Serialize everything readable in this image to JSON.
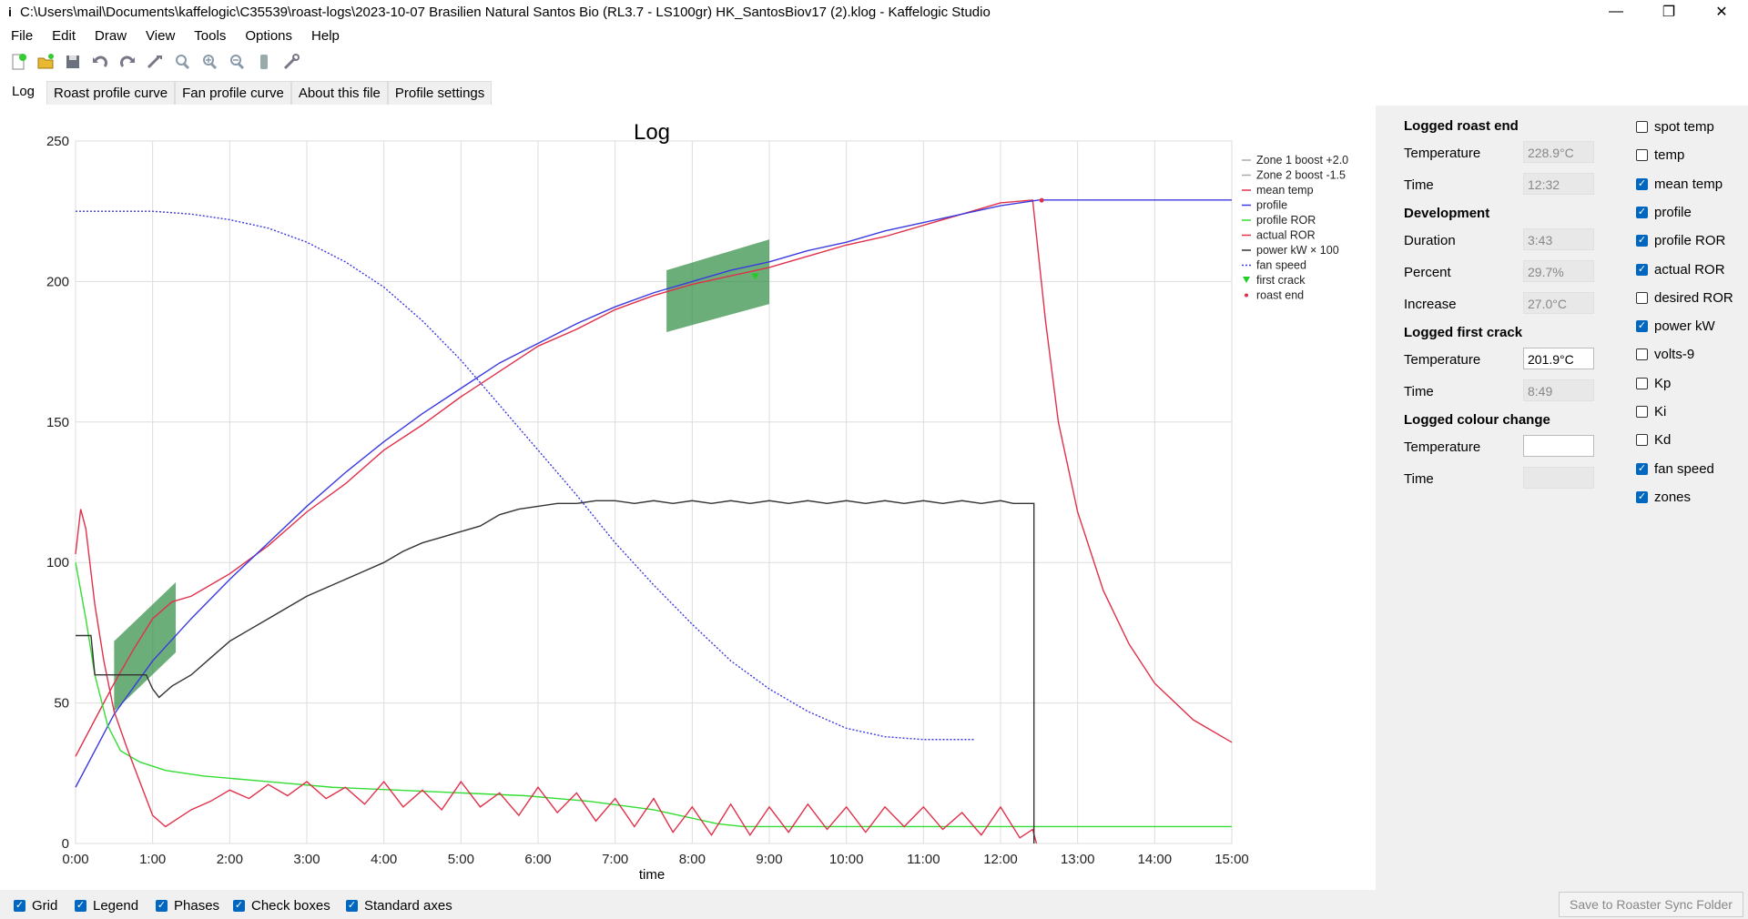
{
  "window": {
    "title": "C:\\Users\\mail\\Documents\\kaffelogic\\C35539\\roast-logs\\2023-10-07 Brasilien Natural Santos Bio (RL3.7 - LS100gr) HK_SantosBiov17 (2).klog - Kaffelogic Studio",
    "minimize": "—",
    "restore": "❐",
    "close": "✕"
  },
  "menu": [
    "File",
    "Edit",
    "Draw",
    "View",
    "Tools",
    "Options",
    "Help"
  ],
  "toolbar_icons": [
    "new-file-icon",
    "open-folder-icon",
    "save-icon",
    "undo-icon",
    "redo-icon",
    "measure-icon",
    "zoom-reset-icon",
    "zoom-in-icon",
    "zoom-out-icon",
    "roaster-icon",
    "settings-wand-icon"
  ],
  "tabs": [
    "Log",
    "Roast profile curve",
    "Fan profile curve",
    "About this file",
    "Profile settings"
  ],
  "chart_data": {
    "type": "line",
    "title": "Log",
    "xlabel": "time",
    "ylabel": "",
    "xlim": [
      0,
      900
    ],
    "ylim": [
      0,
      250
    ],
    "x_ticks": [
      "0:00",
      "1:00",
      "2:00",
      "3:00",
      "4:00",
      "5:00",
      "6:00",
      "7:00",
      "8:00",
      "9:00",
      "10:00",
      "11:00",
      "12:00",
      "13:00",
      "14:00",
      "15:00"
    ],
    "y_ticks": [
      0,
      50,
      100,
      150,
      200,
      250
    ],
    "grid": true,
    "legend_position": "top-right",
    "legend": [
      {
        "name": "Zone 1 boost +2.0",
        "color": "#aaaaaa",
        "style": "line"
      },
      {
        "name": "Zone 2 boost -1.5",
        "color": "#aaaaaa",
        "style": "line"
      },
      {
        "name": "mean temp",
        "color": "#e0304a",
        "style": "line"
      },
      {
        "name": "profile",
        "color": "#3a3ae0",
        "style": "line"
      },
      {
        "name": "profile ROR",
        "color": "#33dd33",
        "style": "line"
      },
      {
        "name": "actual ROR",
        "color": "#e0304a",
        "style": "line"
      },
      {
        "name": "power kW × 100",
        "color": "#333333",
        "style": "line"
      },
      {
        "name": "fan speed",
        "color": "#3a3ae0",
        "style": "dotted"
      },
      {
        "name": "first crack",
        "color": "#22cc22",
        "style": "triangle"
      },
      {
        "name": "roast end",
        "color": "#e0304a",
        "style": "dot"
      }
    ],
    "zones": [
      {
        "name": "Zone 1 boost +2.0",
        "points": [
          [
            30,
            47
          ],
          [
            30,
            72
          ],
          [
            78,
            93
          ],
          [
            78,
            68
          ]
        ],
        "color": "#2e8b40"
      },
      {
        "name": "Zone 2 boost -1.5",
        "points": [
          [
            460,
            182
          ],
          [
            460,
            204
          ],
          [
            540,
            215
          ],
          [
            540,
            192
          ]
        ],
        "color": "#2e8b40"
      }
    ],
    "series": [
      {
        "name": "mean temp",
        "color": "#e0304a",
        "points": [
          [
            0,
            31
          ],
          [
            15,
            44
          ],
          [
            30,
            57
          ],
          [
            45,
            69
          ],
          [
            60,
            80
          ],
          [
            75,
            86
          ],
          [
            90,
            88
          ],
          [
            120,
            96
          ],
          [
            150,
            106
          ],
          [
            180,
            118
          ],
          [
            210,
            128
          ],
          [
            240,
            140
          ],
          [
            270,
            149
          ],
          [
            300,
            159
          ],
          [
            330,
            168
          ],
          [
            360,
            177
          ],
          [
            390,
            183
          ],
          [
            420,
            190
          ],
          [
            450,
            195
          ],
          [
            480,
            199
          ],
          [
            510,
            202
          ],
          [
            540,
            205
          ],
          [
            570,
            209
          ],
          [
            600,
            213
          ],
          [
            630,
            216
          ],
          [
            660,
            220
          ],
          [
            690,
            224
          ],
          [
            720,
            228
          ],
          [
            745,
            229
          ],
          [
            755,
            186
          ],
          [
            765,
            150
          ],
          [
            780,
            118
          ],
          [
            800,
            90
          ],
          [
            820,
            71
          ],
          [
            840,
            57
          ],
          [
            870,
            44
          ],
          [
            900,
            36
          ]
        ]
      },
      {
        "name": "profile",
        "color": "#3a3ae0",
        "points": [
          [
            0,
            20
          ],
          [
            30,
            46
          ],
          [
            60,
            65
          ],
          [
            90,
            80
          ],
          [
            120,
            94
          ],
          [
            150,
            107
          ],
          [
            180,
            120
          ],
          [
            210,
            132
          ],
          [
            240,
            143
          ],
          [
            270,
            153
          ],
          [
            300,
            162
          ],
          [
            330,
            171
          ],
          [
            360,
            178
          ],
          [
            390,
            185
          ],
          [
            420,
            191
          ],
          [
            450,
            196
          ],
          [
            480,
            200
          ],
          [
            510,
            204
          ],
          [
            540,
            207
          ],
          [
            570,
            211
          ],
          [
            600,
            214
          ],
          [
            630,
            218
          ],
          [
            660,
            221
          ],
          [
            690,
            224
          ],
          [
            720,
            227
          ],
          [
            750,
            229
          ],
          [
            900,
            229
          ]
        ]
      },
      {
        "name": "profile ROR",
        "color": "#33dd33",
        "points": [
          [
            0,
            100
          ],
          [
            8,
            80
          ],
          [
            15,
            60
          ],
          [
            25,
            42
          ],
          [
            35,
            33
          ],
          [
            50,
            29
          ],
          [
            70,
            26
          ],
          [
            100,
            24
          ],
          [
            150,
            22
          ],
          [
            200,
            20
          ],
          [
            250,
            19
          ],
          [
            300,
            18
          ],
          [
            350,
            17
          ],
          [
            400,
            15
          ],
          [
            450,
            12
          ],
          [
            460,
            11
          ],
          [
            480,
            9
          ],
          [
            500,
            7
          ],
          [
            520,
            6
          ],
          [
            900,
            6
          ]
        ]
      },
      {
        "name": "actual ROR",
        "color": "#e0304a",
        "points": [
          [
            0,
            103
          ],
          [
            4,
            119
          ],
          [
            8,
            112
          ],
          [
            15,
            85
          ],
          [
            22,
            65
          ],
          [
            30,
            47
          ],
          [
            40,
            34
          ],
          [
            50,
            22
          ],
          [
            60,
            10
          ],
          [
            70,
            6
          ],
          [
            80,
            9
          ],
          [
            90,
            12
          ],
          [
            105,
            15
          ],
          [
            120,
            19
          ],
          [
            135,
            16
          ],
          [
            150,
            21
          ],
          [
            165,
            17
          ],
          [
            180,
            22
          ],
          [
            195,
            16
          ],
          [
            210,
            20
          ],
          [
            225,
            14
          ],
          [
            240,
            22
          ],
          [
            255,
            13
          ],
          [
            270,
            19
          ],
          [
            285,
            12
          ],
          [
            300,
            22
          ],
          [
            315,
            13
          ],
          [
            330,
            18
          ],
          [
            345,
            10
          ],
          [
            360,
            20
          ],
          [
            375,
            11
          ],
          [
            390,
            18
          ],
          [
            405,
            8
          ],
          [
            420,
            16
          ],
          [
            435,
            6
          ],
          [
            450,
            16
          ],
          [
            465,
            4
          ],
          [
            480,
            13
          ],
          [
            495,
            3
          ],
          [
            510,
            14
          ],
          [
            525,
            3
          ],
          [
            540,
            13
          ],
          [
            555,
            4
          ],
          [
            570,
            14
          ],
          [
            585,
            5
          ],
          [
            600,
            13
          ],
          [
            615,
            4
          ],
          [
            630,
            13
          ],
          [
            645,
            6
          ],
          [
            660,
            13
          ],
          [
            675,
            5
          ],
          [
            690,
            11
          ],
          [
            705,
            3
          ],
          [
            720,
            13
          ],
          [
            735,
            2
          ],
          [
            745,
            5
          ],
          [
            748,
            0
          ]
        ]
      },
      {
        "name": "power kW × 100",
        "color": "#333333",
        "points": [
          [
            0,
            74
          ],
          [
            12,
            74
          ],
          [
            15,
            60
          ],
          [
            55,
            60
          ],
          [
            60,
            55
          ],
          [
            65,
            52
          ],
          [
            75,
            56
          ],
          [
            90,
            60
          ],
          [
            105,
            66
          ],
          [
            120,
            72
          ],
          [
            135,
            76
          ],
          [
            150,
            80
          ],
          [
            165,
            84
          ],
          [
            180,
            88
          ],
          [
            195,
            91
          ],
          [
            210,
            94
          ],
          [
            225,
            97
          ],
          [
            240,
            100
          ],
          [
            255,
            104
          ],
          [
            270,
            107
          ],
          [
            285,
            109
          ],
          [
            300,
            111
          ],
          [
            315,
            113
          ],
          [
            330,
            117
          ],
          [
            345,
            119
          ],
          [
            360,
            120
          ],
          [
            375,
            121
          ],
          [
            390,
            121
          ],
          [
            405,
            122
          ],
          [
            420,
            122
          ],
          [
            435,
            121
          ],
          [
            450,
            122
          ],
          [
            465,
            121
          ],
          [
            480,
            122
          ],
          [
            495,
            121
          ],
          [
            510,
            122
          ],
          [
            525,
            121
          ],
          [
            540,
            122
          ],
          [
            555,
            121
          ],
          [
            570,
            122
          ],
          [
            585,
            121
          ],
          [
            600,
            122
          ],
          [
            615,
            121
          ],
          [
            630,
            122
          ],
          [
            645,
            121
          ],
          [
            660,
            122
          ],
          [
            675,
            121
          ],
          [
            690,
            122
          ],
          [
            705,
            121
          ],
          [
            720,
            122
          ],
          [
            730,
            121
          ],
          [
            746,
            121
          ],
          [
            746,
            0
          ]
        ]
      },
      {
        "name": "fan speed",
        "color": "#3a3ae0",
        "dotted": true,
        "points": [
          [
            0,
            225
          ],
          [
            60,
            225
          ],
          [
            90,
            224
          ],
          [
            120,
            222
          ],
          [
            150,
            219
          ],
          [
            180,
            214
          ],
          [
            210,
            207
          ],
          [
            240,
            198
          ],
          [
            270,
            186
          ],
          [
            300,
            172
          ],
          [
            330,
            156
          ],
          [
            360,
            140
          ],
          [
            390,
            124
          ],
          [
            420,
            107
          ],
          [
            450,
            92
          ],
          [
            480,
            78
          ],
          [
            510,
            65
          ],
          [
            540,
            55
          ],
          [
            570,
            47
          ],
          [
            600,
            41
          ],
          [
            630,
            38
          ],
          [
            660,
            37
          ],
          [
            700,
            37
          ]
        ]
      }
    ],
    "markers": [
      {
        "name": "first crack",
        "x": 529,
        "y": 201.9,
        "color": "#22cc22"
      },
      {
        "name": "roast end",
        "x": 752,
        "y": 228.9,
        "color": "#e0304a"
      }
    ]
  },
  "side": {
    "logged_roast_end": {
      "heading": "Logged roast end",
      "temperature_label": "Temperature",
      "temperature": "228.9°C",
      "time_label": "Time",
      "time": "12:32"
    },
    "development": {
      "heading": "Development",
      "duration_label": "Duration",
      "duration": "3:43",
      "percent_label": "Percent",
      "percent": "29.7%",
      "increase_label": "Increase",
      "increase": "27.0°C"
    },
    "logged_first_crack": {
      "heading": "Logged first crack",
      "temperature_label": "Temperature",
      "temperature": "201.9°C",
      "time_label": "Time",
      "time": "8:49"
    },
    "logged_colour_change": {
      "heading": "Logged colour change",
      "temperature_label": "Temperature",
      "temperature": "",
      "time_label": "Time",
      "time": ""
    }
  },
  "series_checkboxes": [
    {
      "label": "spot temp",
      "checked": false
    },
    {
      "label": "temp",
      "checked": false
    },
    {
      "label": "mean temp",
      "checked": true
    },
    {
      "label": "profile",
      "checked": true
    },
    {
      "label": "profile ROR",
      "checked": true
    },
    {
      "label": "actual ROR",
      "checked": true
    },
    {
      "label": "desired ROR",
      "checked": false
    },
    {
      "label": "power kW",
      "checked": true
    },
    {
      "label": "volts-9",
      "checked": false
    },
    {
      "label": "Kp",
      "checked": false
    },
    {
      "label": "Ki",
      "checked": false
    },
    {
      "label": "Kd",
      "checked": false
    },
    {
      "label": "fan speed",
      "checked": true
    },
    {
      "label": "zones",
      "checked": true
    }
  ],
  "bottom_checkboxes": [
    {
      "label": "Grid",
      "checked": true
    },
    {
      "label": "Legend",
      "checked": true
    },
    {
      "label": "Phases",
      "checked": true
    },
    {
      "label": "Check boxes",
      "checked": true
    },
    {
      "label": "Standard axes",
      "checked": true
    }
  ],
  "save_button": "Save to Roaster Sync Folder"
}
